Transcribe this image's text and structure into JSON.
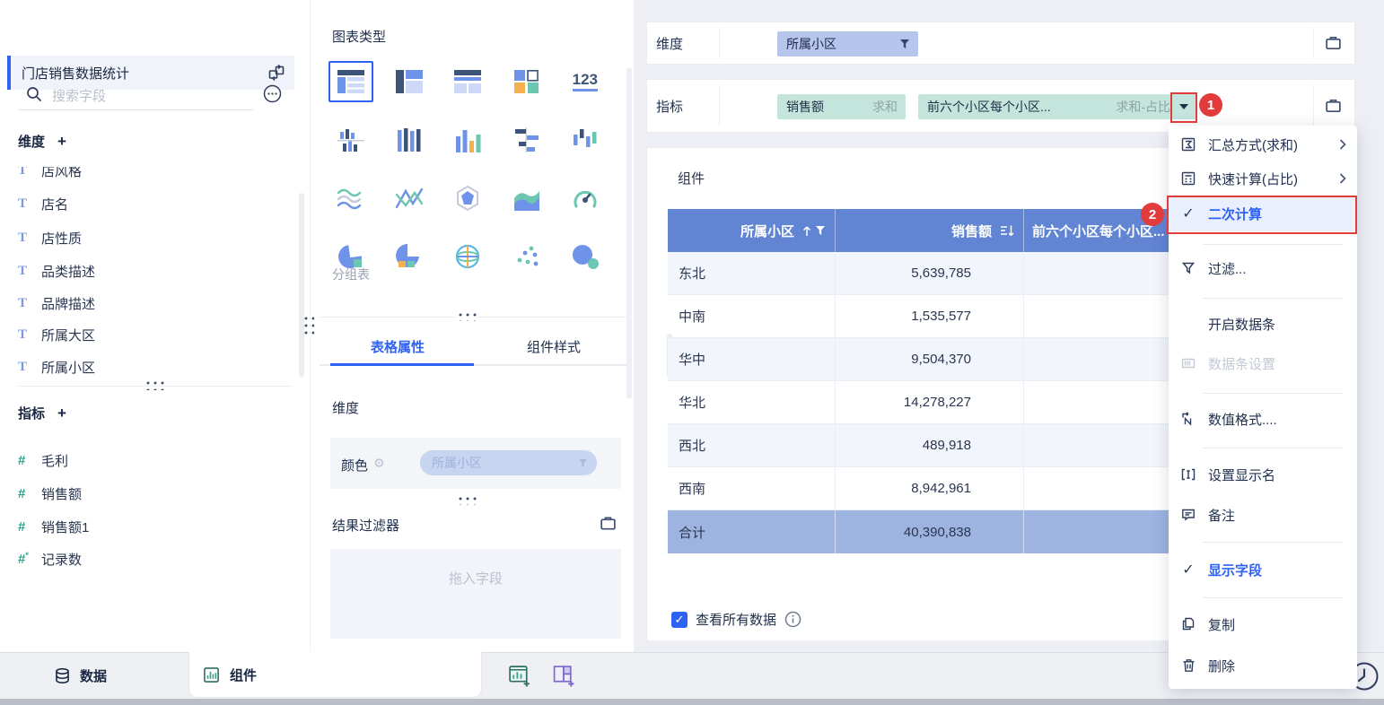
{
  "colors": {
    "primary_blue": "#2e62f5",
    "annotation_red": "#e23b3b",
    "table_header_bg": "#6184d3",
    "table_total_bg": "#9db3e0",
    "dimension_pill_bg": "#b5c5ec",
    "metric_pill_bg": "#c3e5dc",
    "dimension_icon_blue": "#7c9bdb",
    "metric_icon_teal": "#2fa38d"
  },
  "sidebar": {
    "dataset_title": "门店销售数据统计",
    "search_placeholder": "搜索字段",
    "dimensions_label": "维度",
    "metrics_label": "指标",
    "add_label": "+",
    "dimension_fields": [
      "店风格",
      "店名",
      "店性质",
      "品类描述",
      "品牌描述",
      "所属大区",
      "所属小区"
    ],
    "metric_fields": [
      "毛利",
      "销售额",
      "销售额1",
      "记录数"
    ]
  },
  "chart_panel": {
    "title": "图表类型",
    "selected_caption": "分组表",
    "kpi_icon_text": "123",
    "tabs": {
      "table_props": "表格属性",
      "component_style": "组件样式"
    },
    "dimension_section": "维度",
    "color_label": "颜色",
    "color_field": "所属小区",
    "result_filter_label": "结果过滤器",
    "drop_placeholder": "拖入字段"
  },
  "shelf": {
    "dimension_row_label": "维度",
    "metric_row_label": "指标",
    "dimension_pill": {
      "name": "所属小区"
    },
    "metric_pills": [
      {
        "name": "销售额",
        "agg": "求和"
      },
      {
        "name": "前六个小区每个小区...",
        "agg": "求和-占比"
      }
    ]
  },
  "canvas": {
    "title": "组件",
    "view_all_label": "查看所有数据"
  },
  "table": {
    "columns": [
      "所属小区",
      "销售额",
      "前六个小区每个小区..."
    ],
    "rows": [
      {
        "region": "东北",
        "sales": "5,639,785"
      },
      {
        "region": "中南",
        "sales": "1,535,577"
      },
      {
        "region": "华中",
        "sales": "9,504,370"
      },
      {
        "region": "华北",
        "sales": "14,278,227"
      },
      {
        "region": "西北",
        "sales": "489,918"
      },
      {
        "region": "西南",
        "sales": "8,942,961"
      }
    ],
    "total": {
      "label": "合计",
      "sales": "40,390,838"
    }
  },
  "menu": {
    "items": [
      {
        "label": "汇总方式(求和)",
        "icon": "sigma-icon",
        "submenu": true
      },
      {
        "label": "快速计算(占比)",
        "icon": "calculator-icon",
        "submenu": true
      },
      {
        "label": "二次计算",
        "icon": "check-icon",
        "checked": true,
        "highlighted": true
      },
      {
        "label": "过滤...",
        "icon": "funnel-icon"
      },
      {
        "label": "开启数据条"
      },
      {
        "label": "数据条设置",
        "icon": "databar-icon",
        "disabled": true
      },
      {
        "label": "数值格式....",
        "icon": "number-format-icon"
      },
      {
        "label": "设置显示名",
        "icon": "rename-icon"
      },
      {
        "label": "备注",
        "icon": "comment-icon"
      },
      {
        "label": "显示字段",
        "icon": "check-icon",
        "checked": true
      },
      {
        "label": "复制",
        "icon": "copy-icon"
      },
      {
        "label": "删除",
        "icon": "trash-icon"
      }
    ]
  },
  "annotations": {
    "step1": "1",
    "step2": "2"
  },
  "bottom_bar": {
    "data_tab": "数据",
    "component_tab": "组件"
  }
}
